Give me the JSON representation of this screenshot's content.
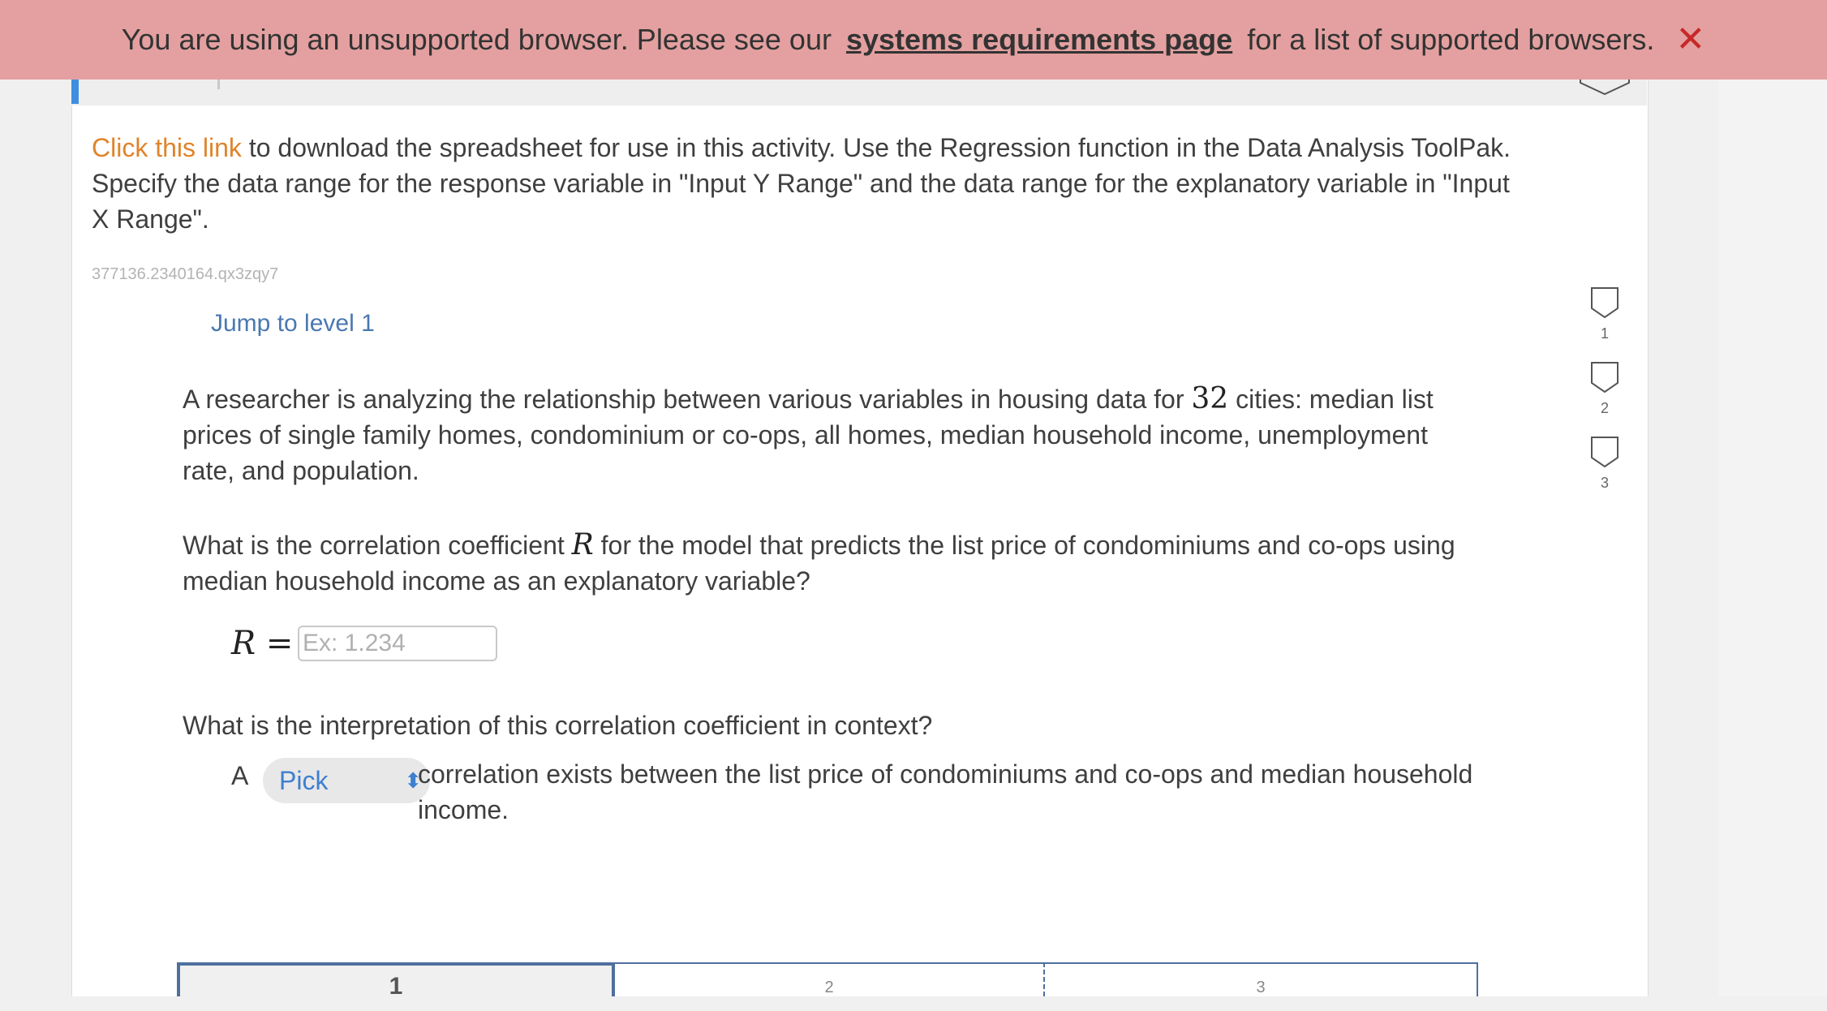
{
  "banner": {
    "text_before": "You are using an unsupported browser. Please see our",
    "link": "systems requirements page",
    "text_after": "for a list of supported browsers.",
    "close_glyph": "✕",
    "background": "#e4a0a0",
    "close_color": "#c62828"
  },
  "intro": {
    "link": "Click this link",
    "text": " to download the spreadsheet for use in this activity. Use the Regression function in the Data Analysis ToolPak. Specify the data range for the response variable in \"Input Y Range\" and the data range for the explanatory variable in \"Input X Range\"."
  },
  "activity_id": "377136.2340164.qx3zqy7",
  "jump_link": "Jump to level 1",
  "question": {
    "p1_before": "A researcher is analyzing the relationship between various variables in housing data for ",
    "p1_number": "32",
    "p1_after": " cities: median list prices of single family homes, condominium or co-ops, all homes, median household income, unemployment rate, and population.",
    "p2_before": "What is the correlation coefficient ",
    "p2_var": "R",
    "p2_after": " for the model that predicts the list price of condominiums and co-ops using median household income as an explanatory variable?",
    "r_label": "R =",
    "r_placeholder": "Ex: 1.234",
    "r_value": "",
    "p3": "What is the interpretation of this correlation coefficient in context?",
    "answer_prefix": "A",
    "select_value": "Pick",
    "answer_rest": "correlation exists between the list price of condominiums and co-ops and median household income."
  },
  "side_levels": [
    "1",
    "2",
    "3"
  ],
  "progress_levels": [
    "1",
    "2",
    "3"
  ],
  "colors": {
    "accent": "#3d8ee0",
    "link_orange": "#e0842a",
    "link_blue": "#4a78b0",
    "progress_border": "#4f6f9f"
  }
}
